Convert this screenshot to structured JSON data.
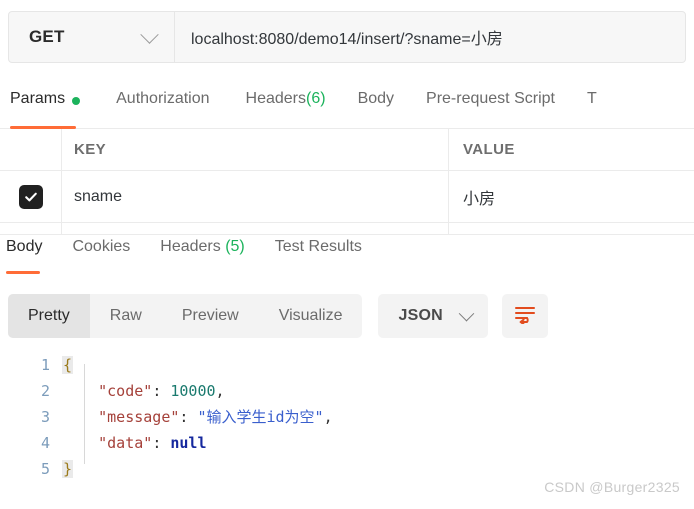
{
  "request_bar": {
    "method": "GET",
    "method_caret_icon": "chevron-down-icon",
    "url": "localhost:8080/demo14/insert/?sname=小房"
  },
  "request_tabs": [
    {
      "label": "Params",
      "active": true,
      "dot": true
    },
    {
      "label": "Authorization",
      "active": false
    },
    {
      "label": "Headers (6)",
      "active": false,
      "label_main": "Headers ",
      "count": "(6)"
    },
    {
      "label": "Body",
      "active": false
    },
    {
      "label": "Pre-request Script",
      "active": false
    },
    {
      "label": "T",
      "active": false
    }
  ],
  "params_table": {
    "columns": [
      "KEY",
      "VALUE"
    ],
    "rows": [
      {
        "checked": true,
        "key": "sname",
        "value": "小房"
      }
    ]
  },
  "response_tabs": [
    {
      "label": "Body",
      "active": true
    },
    {
      "label": "Cookies",
      "active": false
    },
    {
      "label": "Headers (5)",
      "active": false,
      "label_main": "Headers ",
      "count": "(5)"
    },
    {
      "label": "Test Results",
      "active": false
    }
  ],
  "format_bar": {
    "segments": [
      {
        "label": "Pretty",
        "active": true
      },
      {
        "label": "Raw",
        "active": false
      },
      {
        "label": "Preview",
        "active": false
      },
      {
        "label": "Visualize",
        "active": false
      }
    ],
    "language": "JSON",
    "language_caret_icon": "chevron-down-icon",
    "wrap_button_icon": "wrap-text-icon"
  },
  "code_viewer": {
    "line_numbers": [
      "1",
      "2",
      "3",
      "4",
      "5"
    ],
    "lines": [
      {
        "n": "1",
        "open_brace": "{"
      },
      {
        "n": "2",
        "key": "\"code\"",
        "colon": ": ",
        "num": "10000",
        "comma": ","
      },
      {
        "n": "3",
        "key": "\"message\"",
        "colon": ": ",
        "str": "\"输入学生id为空\"",
        "comma": ","
      },
      {
        "n": "4",
        "key": "\"data\"",
        "colon": ": ",
        "nullv": "null"
      },
      {
        "n": "5",
        "close_brace": "}"
      }
    ]
  },
  "watermark": "CSDN @Burger2325",
  "colors": {
    "accent_orange": "#ff6c37",
    "status_green": "#1cb35c",
    "json_key": "#a5413a",
    "json_number": "#1a7a6e",
    "json_string": "#3a5fcd",
    "json_null": "#16299e",
    "brace": "#9b7a1a"
  }
}
